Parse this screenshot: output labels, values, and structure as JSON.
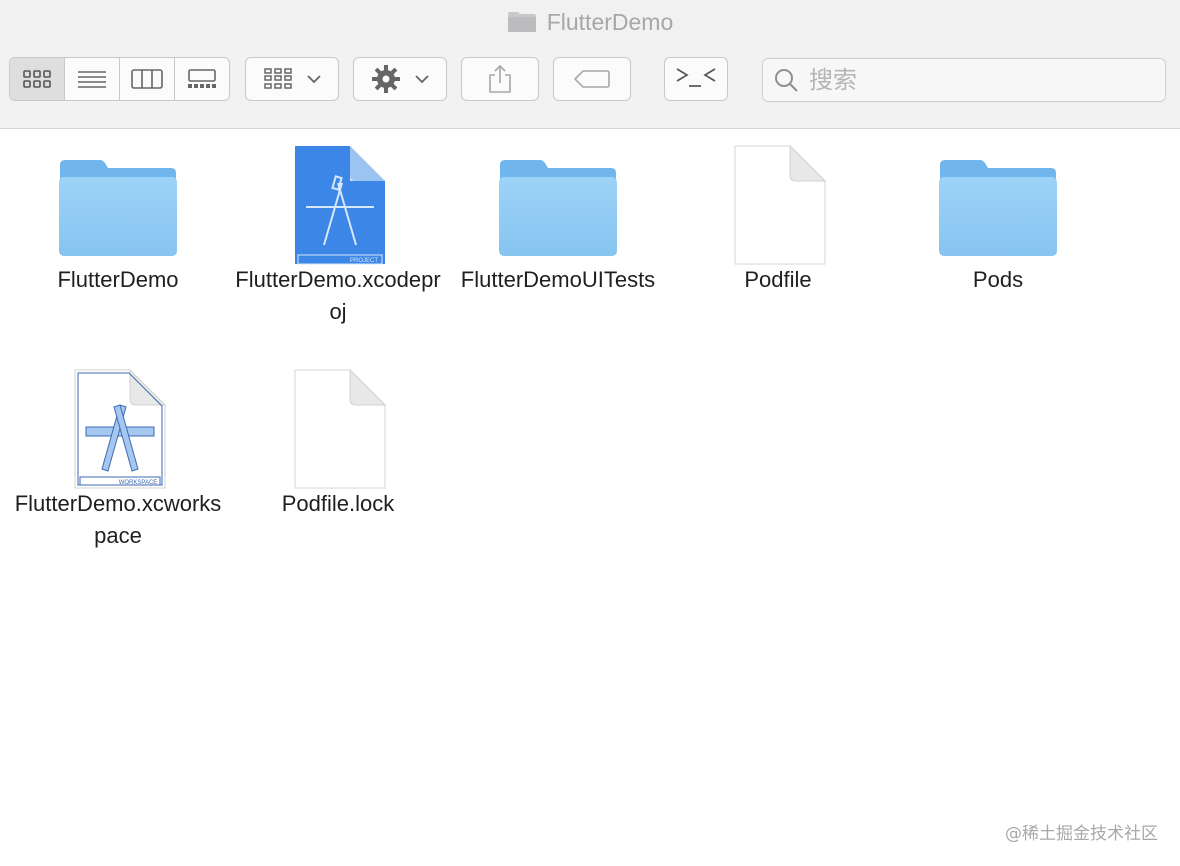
{
  "window": {
    "title": "FlutterDemo"
  },
  "toolbar": {
    "view_buttons": [
      {
        "icon": "icon-view-icon",
        "active": true
      },
      {
        "icon": "list-view-icon",
        "active": false
      },
      {
        "icon": "column-view-icon",
        "active": false
      },
      {
        "icon": "gallery-view-icon",
        "active": false
      }
    ],
    "group_icon": "group-by-icon",
    "action_icon": "gear-icon",
    "share_icon": "share-icon",
    "tag_icon": "tag-icon",
    "terminal_icon": "terminal-icon",
    "search_placeholder": "搜索"
  },
  "files": [
    {
      "name": "FlutterDemo",
      "kind": "folder"
    },
    {
      "name": "FlutterDemo.xcodeproj",
      "kind": "xcodeproj",
      "badge": "PROJECT"
    },
    {
      "name": "FlutterDemoUITests",
      "kind": "folder"
    },
    {
      "name": "Podfile",
      "kind": "document"
    },
    {
      "name": "Pods",
      "kind": "folder"
    },
    {
      "name": "FlutterDemo.xcworkspace",
      "kind": "xcworkspace",
      "badge": "WORKSPACE"
    },
    {
      "name": "Podfile.lock",
      "kind": "document"
    }
  ],
  "watermark": "@稀土掘金技术社区"
}
